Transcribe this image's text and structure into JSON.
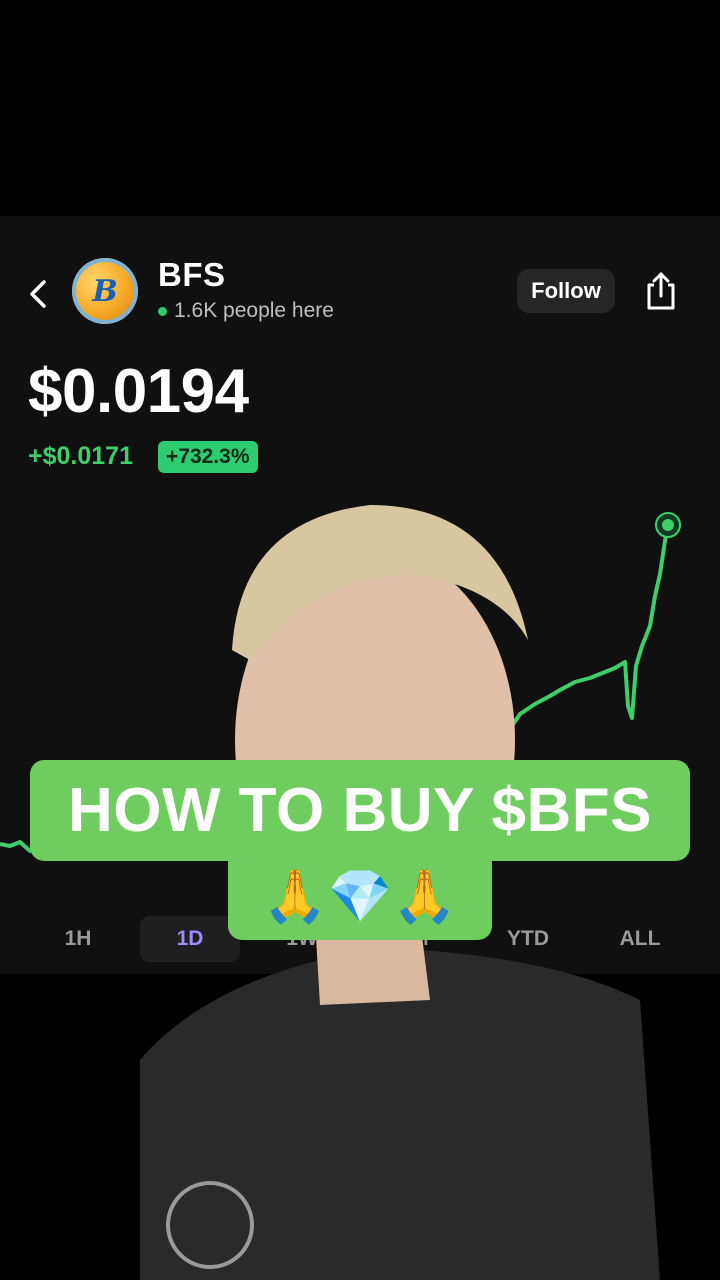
{
  "header": {
    "title": "BFS",
    "presence": "1.6K people here",
    "follow_label": "Follow",
    "logo_text": "B"
  },
  "quote": {
    "price": "$0.0194",
    "change": "+$0.0171",
    "percent": "+732.3%"
  },
  "ranges": [
    "1H",
    "1D",
    "1W",
    "1M",
    "YTD",
    "ALL"
  ],
  "active_range": "1D",
  "caption": {
    "line1": "HOW TO BUY $BFS",
    "line2": "🙏💎🙏"
  },
  "colors": {
    "up_green": "#3ecf6a",
    "caption_green": "#6fcd5f",
    "active_tab": "#9b8cff"
  },
  "icons": [
    "back-chevron-icon",
    "share-icon",
    "presence-dot-icon"
  ]
}
